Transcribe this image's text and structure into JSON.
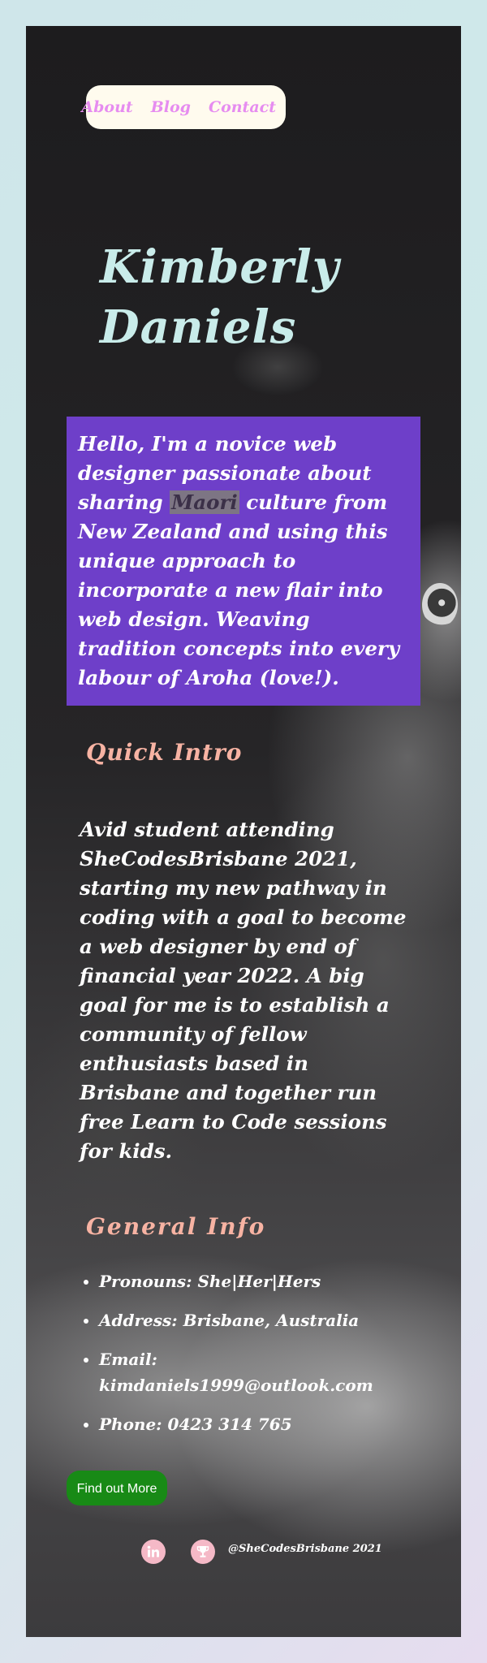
{
  "nav": {
    "items": [
      "About",
      "Blog",
      "Contact"
    ]
  },
  "hero": {
    "name_line1": "Kimberly",
    "name_line2": "Daniels"
  },
  "intro": {
    "before": "Hello, I'm a novice web designer passionate about sharing ",
    "highlight": "Maori",
    "after": " culture from New Zealand and using this unique approach to incorporate a new flair into web design. Weaving tradition concepts into every labour of Aroha (love!)."
  },
  "quick_intro": {
    "title": "Quick Intro",
    "text": "Avid student attending SheCodesBrisbane 2021, starting my new pathway in coding with a goal to become a web designer by end of financial year 2022. A big goal for me is to establish a community of fellow enthusiasts based in Brisbane and together run free Learn to Code sessions for kids."
  },
  "general_info": {
    "title": "General Info",
    "items": [
      "Pronouns: She|Her|Hers",
      "Address: Brisbane, Australia",
      "Email: kimdaniels1999@outlook.com",
      "Phone: 0423 314 765"
    ]
  },
  "cta": {
    "label": "Find out More"
  },
  "footer": {
    "handle": "@SheCodesBrisbane 2021",
    "icons": [
      "linkedin-icon",
      "trophy-icon"
    ]
  },
  "colors": {
    "nav_bg": "#fffbee",
    "nav_link": "#e68cf0",
    "name": "#c9ecea",
    "intro_bg": "#6e3fc9",
    "section_title": "#f7b3a3",
    "cta_bg": "#188a16",
    "icon_bg": "#f5b9c7"
  }
}
